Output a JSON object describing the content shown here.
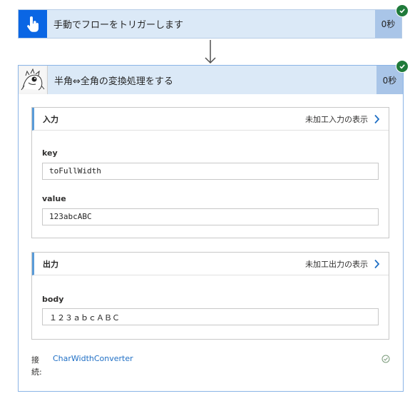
{
  "trigger": {
    "title": "手動でフローをトリガーします",
    "duration": "0秒",
    "icon": "hand-tap-icon",
    "status": "success"
  },
  "action": {
    "title": "半角⇔全角の変換処理をする",
    "duration": "0秒",
    "icon": "custom-connector-avatar-icon",
    "status": "success",
    "inputs": {
      "label": "入力",
      "raw_link": "未加工入力の表示",
      "fields": [
        {
          "label": "key",
          "value": "toFullWidth"
        },
        {
          "label": "value",
          "value": "123abcABC"
        }
      ]
    },
    "outputs": {
      "label": "出力",
      "raw_link": "未加工出力の表示",
      "fields": [
        {
          "label": "body",
          "value": "１２３ａｂｃＡＢＣ"
        }
      ]
    },
    "connection": {
      "label": "接続:",
      "name": "CharWidthConverter",
      "status_icon": "check-circle-icon"
    }
  },
  "colors": {
    "trigger_accent": "#0a66e4",
    "header_bg": "#dbe9f7",
    "duration_bg": "#a9c5e8",
    "success": "#1f7a3a",
    "link": "#1f6fc5"
  }
}
